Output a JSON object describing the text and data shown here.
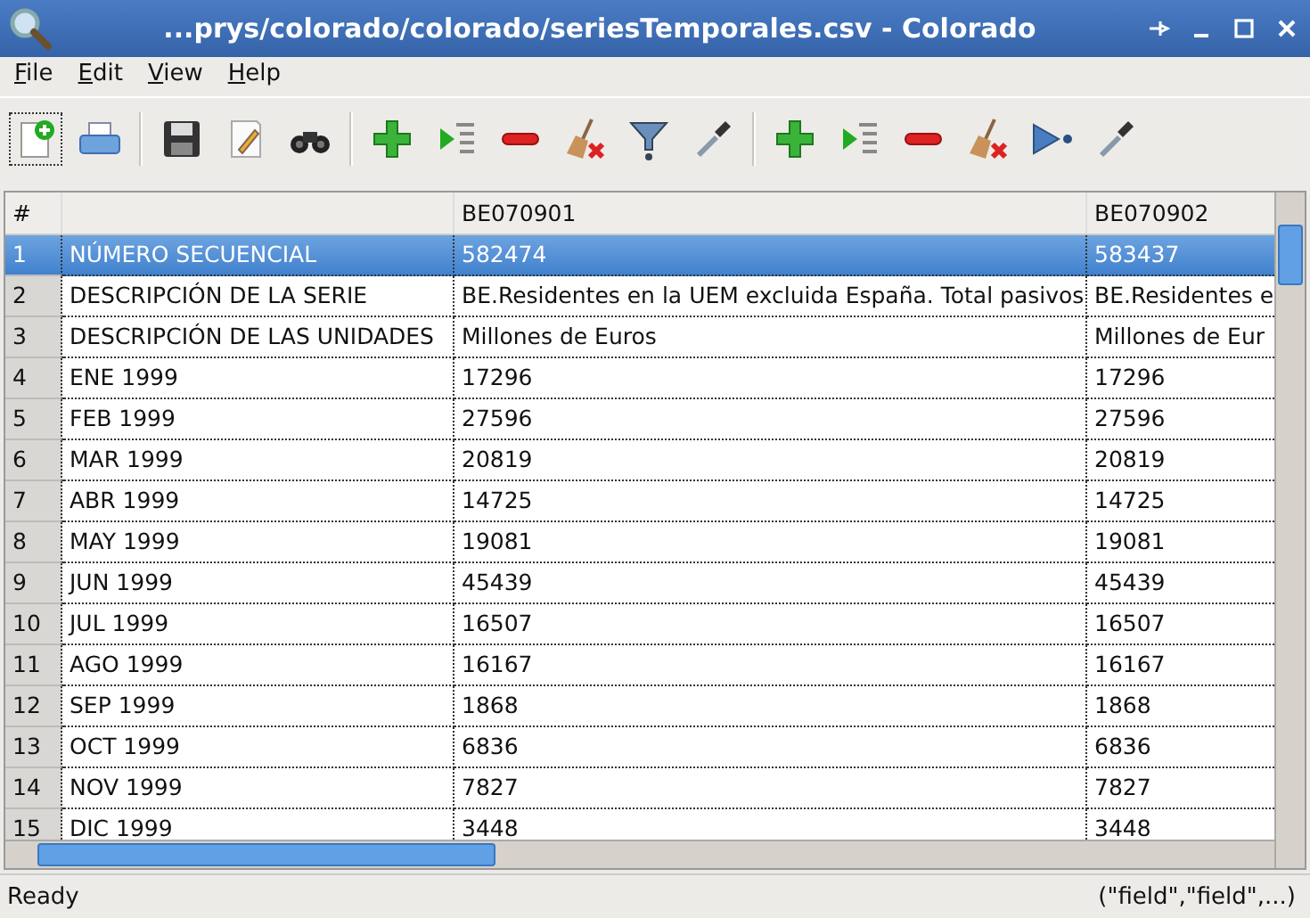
{
  "window": {
    "title": "...prys/colorado/colorado/seriesTemporales.csv - Colorado"
  },
  "menu": [
    "File",
    "Edit",
    "View",
    "Help"
  ],
  "table": {
    "columns": [
      "#",
      "",
      "BE070901",
      "BE070902"
    ],
    "rows": [
      {
        "cells": [
          "1",
          "NÚMERO SECUENCIAL",
          "582474",
          "583437"
        ],
        "selected": true
      },
      {
        "cells": [
          "2",
          "DESCRIPCIÓN DE LA SERIE",
          "BE.Residentes en la UEM excluida España. Total pasivos",
          "BE.Residentes e"
        ],
        "selected": false
      },
      {
        "cells": [
          "3",
          "DESCRIPCIÓN DE LAS UNIDADES",
          "Millones de Euros",
          "Millones de Eur"
        ],
        "selected": false
      },
      {
        "cells": [
          "4",
          "ENE 1999",
          "17296",
          "17296"
        ],
        "selected": false
      },
      {
        "cells": [
          "5",
          "FEB 1999",
          "27596",
          "27596"
        ],
        "selected": false
      },
      {
        "cells": [
          "6",
          "MAR 1999",
          "20819",
          "20819"
        ],
        "selected": false
      },
      {
        "cells": [
          "7",
          "ABR 1999",
          "14725",
          "14725"
        ],
        "selected": false
      },
      {
        "cells": [
          "8",
          "MAY 1999",
          "19081",
          "19081"
        ],
        "selected": false
      },
      {
        "cells": [
          "9",
          "JUN 1999",
          "45439",
          "45439"
        ],
        "selected": false
      },
      {
        "cells": [
          "10",
          "JUL 1999",
          "16507",
          "16507"
        ],
        "selected": false
      },
      {
        "cells": [
          "11",
          "AGO 1999",
          "16167",
          "16167"
        ],
        "selected": false
      },
      {
        "cells": [
          "12",
          "SEP 1999",
          "1868",
          "1868"
        ],
        "selected": false
      },
      {
        "cells": [
          "13",
          "OCT 1999",
          "6836",
          "6836"
        ],
        "selected": false
      },
      {
        "cells": [
          "14",
          "NOV 1999",
          "7827",
          "7827"
        ],
        "selected": false
      },
      {
        "cells": [
          "15",
          "DIC 1999",
          "3448",
          "3448"
        ],
        "selected": false
      }
    ]
  },
  "status_bar": {
    "message": "Ready",
    "format": "(\"field\",\"field\",...)"
  }
}
